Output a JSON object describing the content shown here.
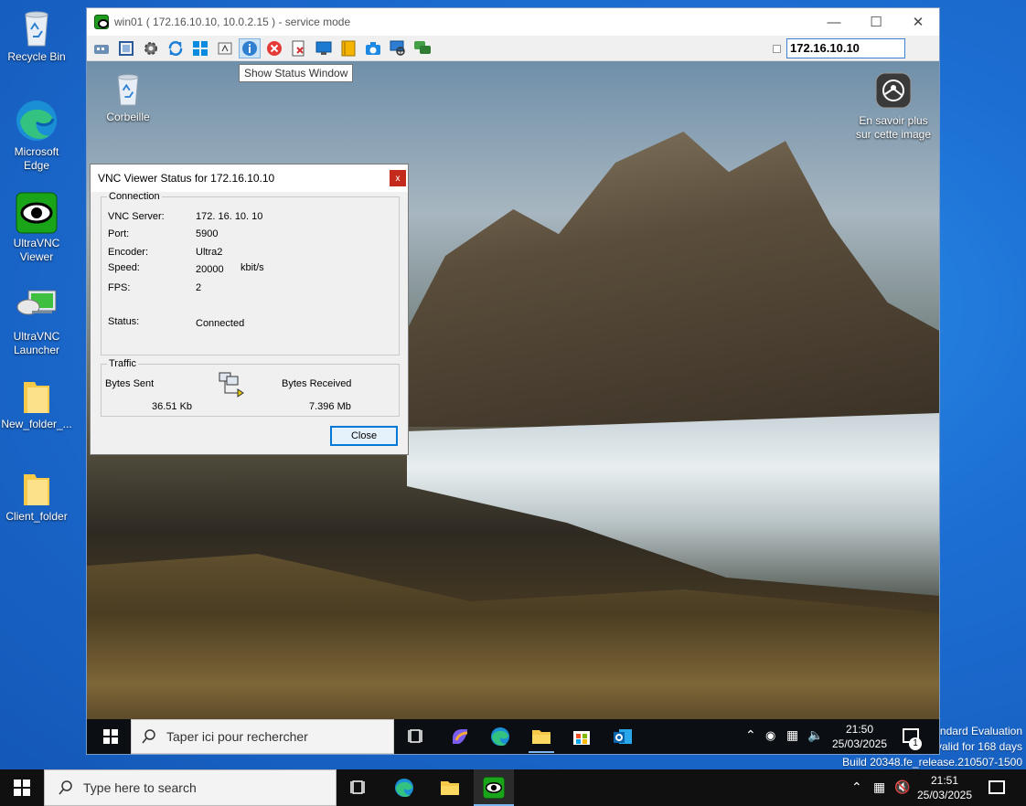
{
  "desktop_icons": [
    {
      "label": "Recycle Bin"
    },
    {
      "label": "Microsoft Edge"
    },
    {
      "label": "UltraVNC Viewer"
    },
    {
      "label": "UltraVNC Launcher"
    },
    {
      "label": "New_folder_..."
    },
    {
      "label": "Client_folder"
    }
  ],
  "viewer": {
    "title": "win01 ( 172.16.10.10, 10.0.2.15 ) - service mode",
    "host_input_value": "172.16.10.10",
    "tooltip": "Show Status Window"
  },
  "remote_desktop": {
    "recycle_label": "Corbeille",
    "spotlight_label_line1": "En savoir plus",
    "spotlight_label_line2": "sur cette image",
    "search_placeholder": "Taper ici pour rechercher",
    "time": "21:50",
    "date": "25/03/2025",
    "notification_count": "1"
  },
  "status_dialog": {
    "title": "VNC Viewer Status for 172.16.10.10",
    "connection_legend": "Connection",
    "vnc_server_label": "VNC Server:",
    "vnc_server_value": "172. 16. 10. 10",
    "port_label": "Port:",
    "port_value": "5900",
    "encoder_label": "Encoder:",
    "encoder_value": "Ultra2",
    "speed_label": "Speed:",
    "speed_value": "20000",
    "speed_unit": "kbit/s",
    "fps_label": "FPS:",
    "fps_value": "2",
    "status_label": "Status:",
    "status_value": "Connected",
    "traffic_legend": "Traffic",
    "bytes_sent_label": "Bytes Sent",
    "bytes_sent_value": "36.51 Kb",
    "bytes_received_label": "Bytes Received",
    "bytes_received_value": "7.396 Mb",
    "close_label": "Close"
  },
  "watermark": {
    "line1": "ndard Evaluation",
    "line2": "valid for 168 days",
    "line3": "Build 20348.fe_release.210507-1500"
  },
  "taskbar": {
    "search_placeholder": "Type here to search",
    "time": "21:51",
    "date": "25/03/2025"
  },
  "colors": {
    "desktop_blue": "#1f6fd0",
    "accent": "#0078d7",
    "close_red": "#c42b1c"
  }
}
